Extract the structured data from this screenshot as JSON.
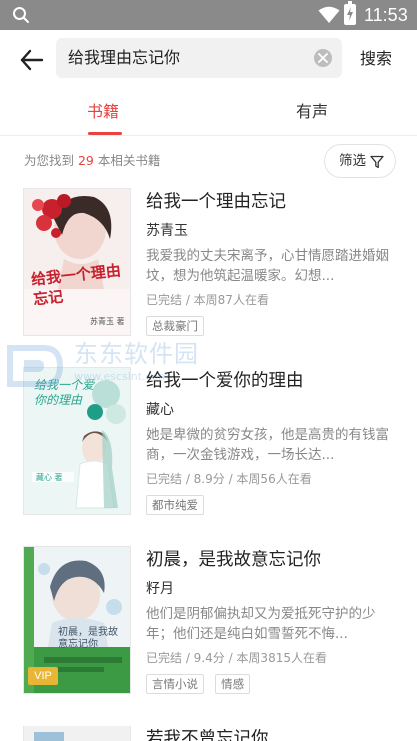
{
  "status_bar": {
    "time": "11:53"
  },
  "search": {
    "query": "给我理由忘记你",
    "submit_label": "搜索"
  },
  "tabs": [
    {
      "label": "书籍",
      "active": true
    },
    {
      "label": "有声",
      "active": false
    }
  ],
  "results": {
    "prefix": "为您找到 ",
    "count": "29",
    "suffix": " 本相关书籍",
    "filter_label": "筛选"
  },
  "books": [
    {
      "title": "给我一个理由忘记",
      "author": "苏青玉",
      "description": "我爱我的丈夫宋离予，心甘情愿踏进婚姻坟，想为他筑起温暖家。幻想...",
      "meta": "已完结 / 本周87人在看",
      "tags": [
        "总裁豪门"
      ],
      "cover_text": "给我一个理由忘记",
      "cover_author": "苏青玉 著"
    },
    {
      "title": "给我一个爱你的理由",
      "author": "藏心",
      "description": "她是卑微的贫穷女孩，他是高贵的有钱富商，一次金钱游戏，一场长达...",
      "meta": "已完结 / 8.9分 / 本周56人在看",
      "tags": [
        "都市纯爱"
      ],
      "cover_text": "给我一个爱你的理由",
      "cover_author": "藏心 著"
    },
    {
      "title": "初晨，是我故意忘记你",
      "author": "籽月",
      "description": "他们是阴郁偏执却又为爱抵死守护的少年；他们还是纯白如雪誓死不悔...",
      "meta": "已完结 / 9.4分 / 本周3815人在看",
      "tags": [
        "言情小说",
        "情感"
      ],
      "cover_text": "初晨，是我故意忘记你",
      "cover_badge": "VIP"
    },
    {
      "title": "若我不曾忘记你"
    }
  ],
  "watermark": {
    "text": "东东软件园",
    "url": "www.escslnt.com"
  },
  "colors": {
    "accent": "#e8433f",
    "status_bar": "#8a8a8a"
  }
}
